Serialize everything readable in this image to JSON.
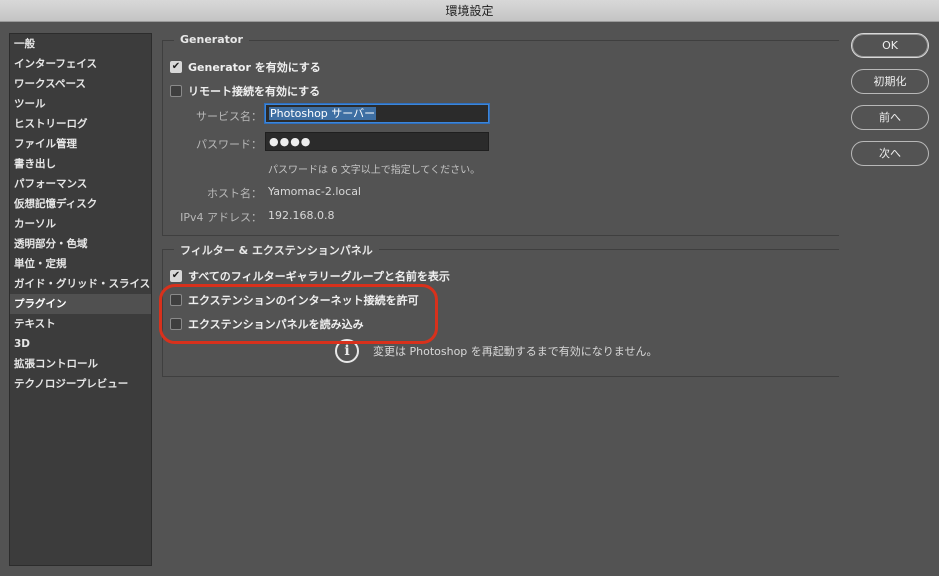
{
  "window": {
    "title": "環境設定"
  },
  "sidebar": {
    "items": [
      {
        "label": "一般"
      },
      {
        "label": "インターフェイス"
      },
      {
        "label": "ワークスペース"
      },
      {
        "label": "ツール"
      },
      {
        "label": "ヒストリーログ"
      },
      {
        "label": "ファイル管理"
      },
      {
        "label": "書き出し"
      },
      {
        "label": "パフォーマンス"
      },
      {
        "label": "仮想記憶ディスク"
      },
      {
        "label": "カーソル"
      },
      {
        "label": "透明部分・色域"
      },
      {
        "label": "単位・定規"
      },
      {
        "label": "ガイド・グリッド・スライス"
      },
      {
        "label": "プラグイン",
        "selected": true
      },
      {
        "label": "テキスト"
      },
      {
        "label": "3D"
      },
      {
        "label": "拡張コントロール"
      },
      {
        "label": "テクノロジープレビュー"
      }
    ]
  },
  "generator": {
    "title": "Generator",
    "enable_label": "Generator を有効にする",
    "enable_checked": true,
    "remote_label": "リモート接続を有効にする",
    "remote_checked": false,
    "service_name_label": "サービス名：",
    "service_name_value": "Photoshop サーバー",
    "password_label": "パスワード：",
    "password_value": "●●●●",
    "password_hint": "パスワードは 6 文字以上で指定してください。",
    "host_label": "ホスト名：",
    "host_value": "Yamomac-2.local",
    "ipv4_label": "IPv4 アドレス：",
    "ipv4_value": "192.168.0.8"
  },
  "filters": {
    "title": "フィルター & エクステンションパネル",
    "show_all_label": "すべてのフィルターギャラリーグループと名前を表示",
    "show_all_checked": true,
    "allow_internet_label": "エクステンションのインターネット接続を許可",
    "allow_internet_checked": false,
    "load_panels_label": "エクステンションパネルを読み込み",
    "load_panels_checked": false,
    "restart_notice": "変更は Photoshop を再起動するまで有効になりません。"
  },
  "buttons": {
    "ok": "OK",
    "reset": "初期化",
    "prev": "前へ",
    "next": "次へ"
  },
  "icons": {
    "check": "✔",
    "info": "i"
  },
  "colors": {
    "highlight": "#d8311c",
    "focus": "#3d86d9"
  }
}
